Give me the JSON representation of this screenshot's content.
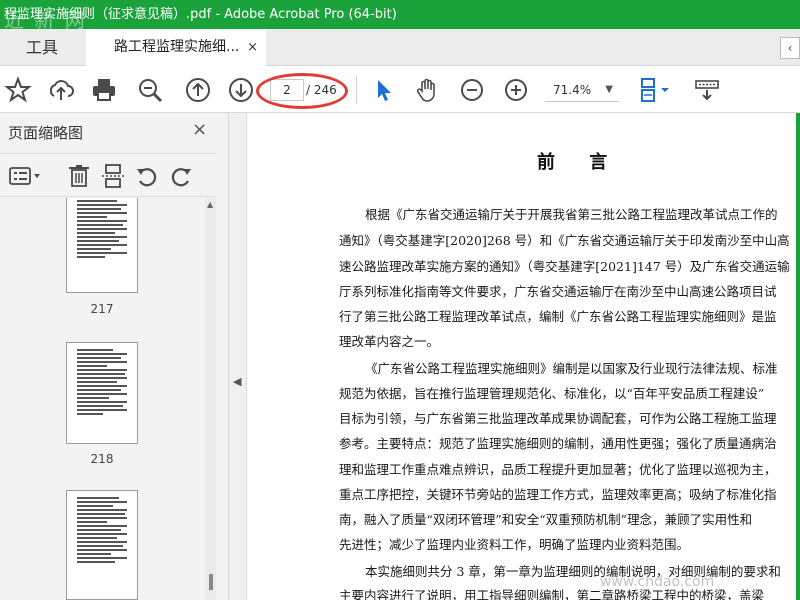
{
  "window": {
    "title": "程监理实施细则（征求意见稿）.pdf - Adobe Acrobat Pro (64-bit)",
    "watermark_top": "近 新 网"
  },
  "tabs": {
    "tools_label": "工具",
    "doc_label": "路工程监理实施细...",
    "close_symbol": "×",
    "nav_symbol": "‹"
  },
  "toolbar": {
    "page_current": "2",
    "page_total": "/ 246",
    "zoom_value": "71.4%",
    "zoom_caret": "▼"
  },
  "sidebar": {
    "title": "页面缩略图",
    "close_symbol": "×",
    "thumbnails": [
      {
        "label": "217"
      },
      {
        "label": "218"
      },
      {
        "label": ""
      }
    ]
  },
  "document": {
    "heading": "前 言",
    "lines": [
      "根据《广东省交通运输厅关于开展我省第三批公路工程监理改革试点工作的",
      "通知》（粤交基建字[2020]268 号）和《广东省交通运输厅关于印发南沙至中山高",
      "速公路监理改革实施方案的通知》（粤交基建字[2021]147 号）及广东省交通运输",
      "厅系列标准化指南等文件要求，广东省交通运输厅在南沙至中山高速公路项目试",
      "行了第三批公路工程监理改革试点，编制《广东省公路工程监理实施细则》是监",
      "理改革内容之一。",
      "《广东省公路工程监理实施细则》编制是以国家及行业现行法律法规、标准",
      "规范为依据，旨在推行监理管理规范化、标准化，以“百年平安品质工程建设”",
      "目标为引领，与广东省第三批监理改革成果协调配套，可作为公路工程施工监理",
      "参考。主要特点：规范了监理实施细则的编制，通用性更强；强化了质量通病治",
      "理和监理工作重点难点辨识，品质工程提升更加显著；优化了监理以巡视为主，",
      "重点工序把控，关键环节旁站的监理工作方式，监理效率更高；吸纳了标准化指",
      "南，融入了质量“双闭环管理”和安全“双重预防机制”理念，兼顾了实用性和",
      "先进性；减少了监理内业资料工作，明确了监理内业资料范围。",
      "本实施细则共分 3 章，第一章为监理细则的编制说明，对细则编制的要求和",
      "主要内容进行了说明，用工指导细则编制，第二章路桥梁工程中的桥梁，盖梁"
    ],
    "watermark": "www.chdao.com"
  }
}
